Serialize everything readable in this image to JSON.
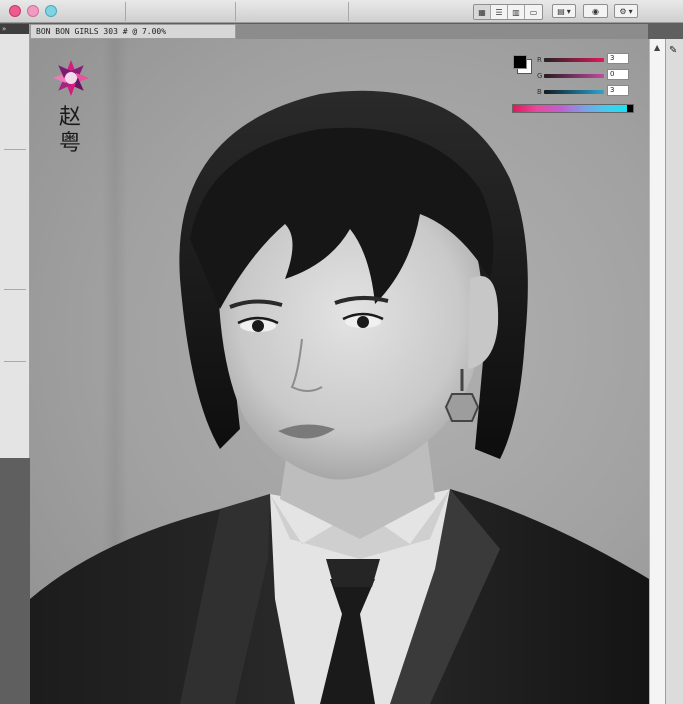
{
  "window": {
    "traffic_lights": [
      "close",
      "minimize",
      "zoom"
    ],
    "toolbar": {
      "view_modes": [
        "grid-view-icon",
        "list-view-icon",
        "column-view-icon",
        "coverflow-view-icon"
      ],
      "active_view": 0,
      "buttons": [
        "arrange-icon",
        "eye-icon",
        "gear-icon"
      ]
    }
  },
  "document": {
    "tab_title": "BON BON GIRLS 303 # @ 7.00%"
  },
  "overlay": {
    "name": "赵粤",
    "logo": "pink-gem-flower-logo"
  },
  "color_panel": {
    "foreground": "#000000",
    "background": "#ffffff",
    "channels": [
      {
        "label": "R",
        "value": "3",
        "colors": [
          "#222222",
          "#e0195c"
        ]
      },
      {
        "label": "G",
        "value": "0",
        "colors": [
          "#2a1a22",
          "#c04aa0"
        ]
      },
      {
        "label": "B",
        "value": "3",
        "colors": [
          "#101a22",
          "#2aa6cf"
        ]
      }
    ]
  },
  "colors": {
    "accent_pink": "#e0195c",
    "accent_cyan": "#10e6f5",
    "chrome": "#d7d7d7"
  }
}
